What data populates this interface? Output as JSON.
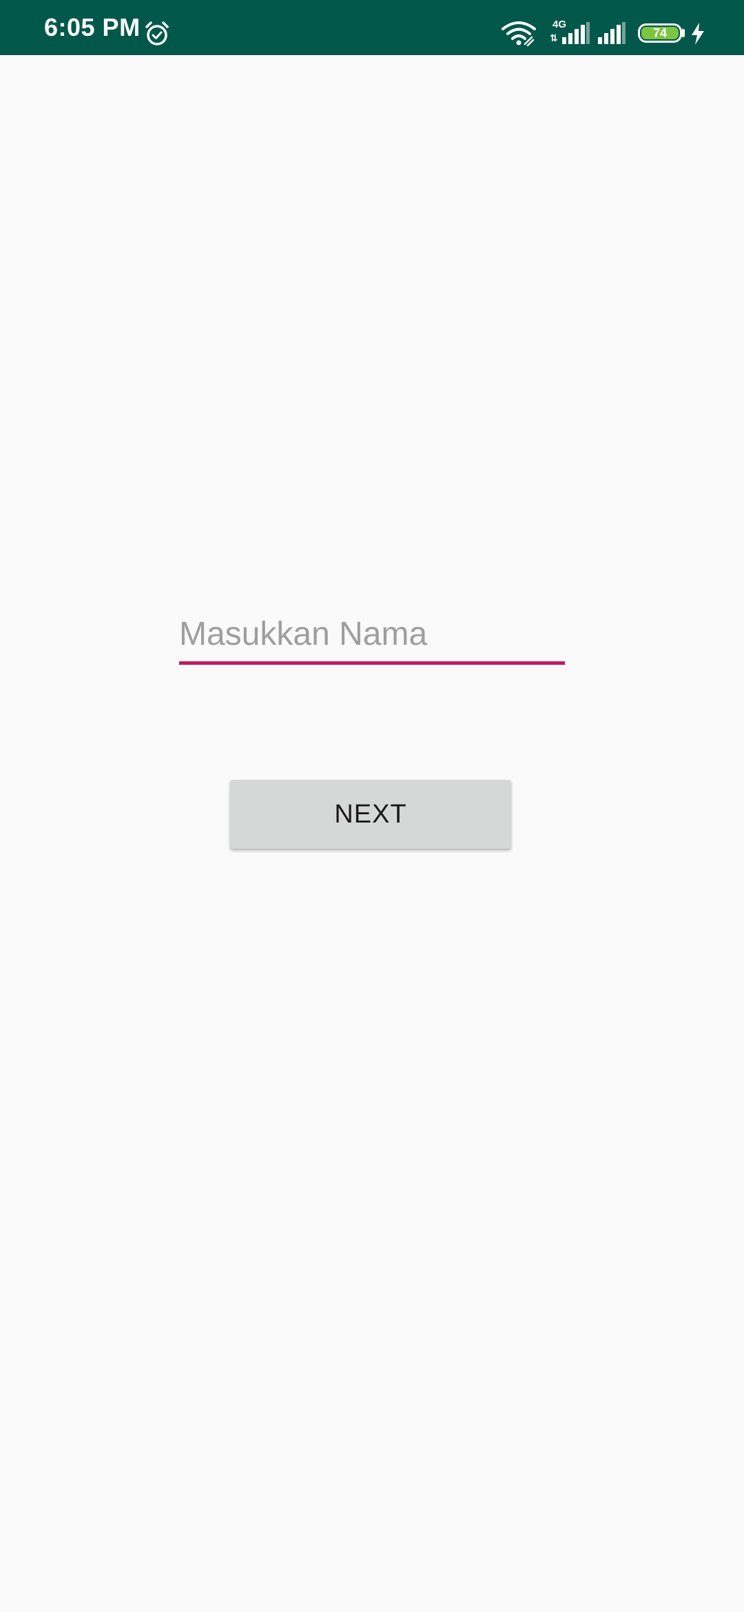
{
  "status_bar": {
    "time": "6:05 PM",
    "network_type": "4G",
    "data_arrows": "⇅",
    "battery_level": "74",
    "background_color": "#01584a",
    "icons": [
      "alarm-icon",
      "wifi-icon",
      "signal-icon",
      "signal-icon",
      "battery-icon",
      "charging-icon"
    ]
  },
  "form": {
    "name_placeholder": "Masukkan Nama",
    "name_value": "",
    "underline_color": "#c2185b",
    "next_label": "NEXT",
    "button_color": "#d6d7d7"
  }
}
